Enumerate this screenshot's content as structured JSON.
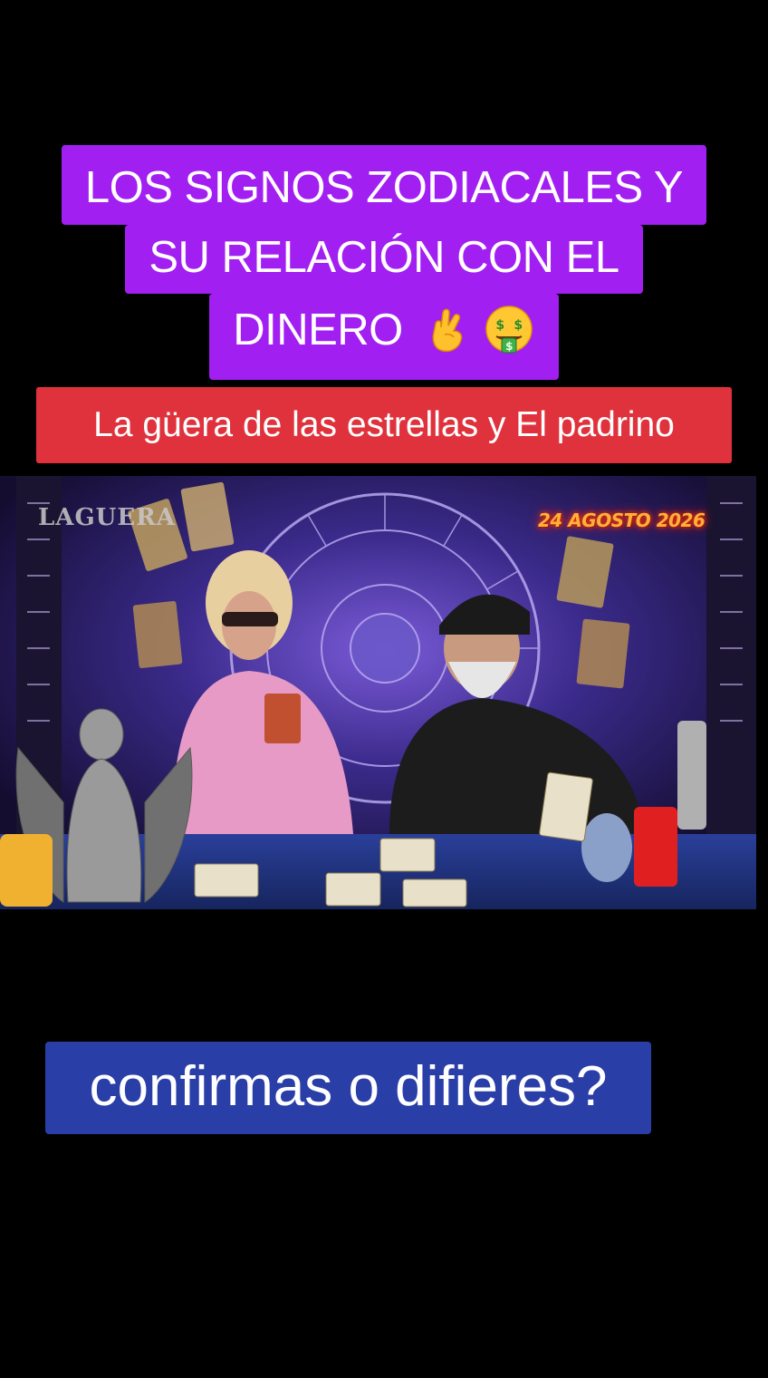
{
  "title": {
    "line1": "LOS SIGNOS ZODIACALES Y",
    "line2": "SU RELACIÓN CON EL",
    "line3": "DINERO",
    "emojis": [
      "crossed-fingers-icon",
      "money-mouth-face-icon"
    ]
  },
  "subtitle": "La güera de las estrellas y El padrino",
  "video": {
    "date_stamp": "24 AGOSTO 2026",
    "brand_mark": "LAGUERA"
  },
  "caption": "confirmas o difieres?",
  "colors": {
    "title_bg": "#a21ff2",
    "subtitle_bg": "#e0323c",
    "caption_bg": "#2a3ea8",
    "page_bg": "#000000"
  }
}
